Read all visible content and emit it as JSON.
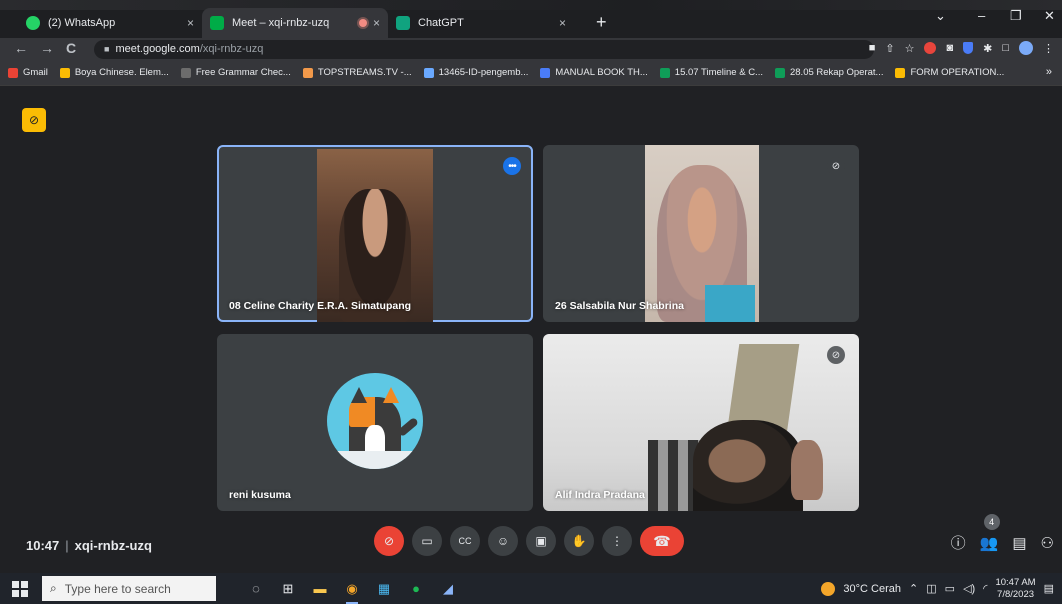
{
  "tabs": [
    {
      "label": "(2) WhatsApp",
      "close": "×",
      "color": "#25d366"
    },
    {
      "label": "Meet – xqi-rnbz-uzq",
      "close": "×",
      "color": "#00ac47",
      "recording": true
    },
    {
      "label": "ChatGPT",
      "close": "×",
      "color": "#10a37f"
    }
  ],
  "new_tab": "+",
  "window_controls": {
    "minimize": "–",
    "maximize": "❐",
    "close": "✕",
    "dropdown": "⌄"
  },
  "omnibox": {
    "host": "meet.google.com",
    "path": "/xqi-rnbz-uzq"
  },
  "bookmarks": [
    {
      "label": "Gmail",
      "color": "#ea4335"
    },
    {
      "label": "Boya Chinese. Elem...",
      "color": "#fbbc04"
    },
    {
      "label": "Free Grammar Chec...",
      "color": "#6c6c6c"
    },
    {
      "label": "TOPSTREAMS.TV -...",
      "color": "#f2994a"
    },
    {
      "label": "13465-ID-pengemb...",
      "color": "#6aa9ff"
    },
    {
      "label": "MANUAL BOOK TH...",
      "color": "#4a7cf7"
    },
    {
      "label": "15.07 Timeline & C...",
      "color": "#0f9d58"
    },
    {
      "label": "28.05 Rekap Operat...",
      "color": "#0f9d58"
    },
    {
      "label": "FORM OPERATION...",
      "color": "#fbbc04"
    }
  ],
  "bookmarks_more": "»",
  "participants": [
    {
      "name": "08 Celine Charity E.R.A. Simatupang"
    },
    {
      "name": "26 Salsabila Nur Shabrina"
    },
    {
      "name": "reni kusuma"
    },
    {
      "name": "Alif Indra Pradana"
    }
  ],
  "meeting": {
    "time": "10:47",
    "separator": "|",
    "code": "xqi-rnbz-uzq",
    "people_count": "4"
  },
  "taskbar": {
    "search_placeholder": "Type here to search",
    "weather": "30°C  Cerah",
    "time": "10:47 AM",
    "date": "7/8/2023"
  }
}
